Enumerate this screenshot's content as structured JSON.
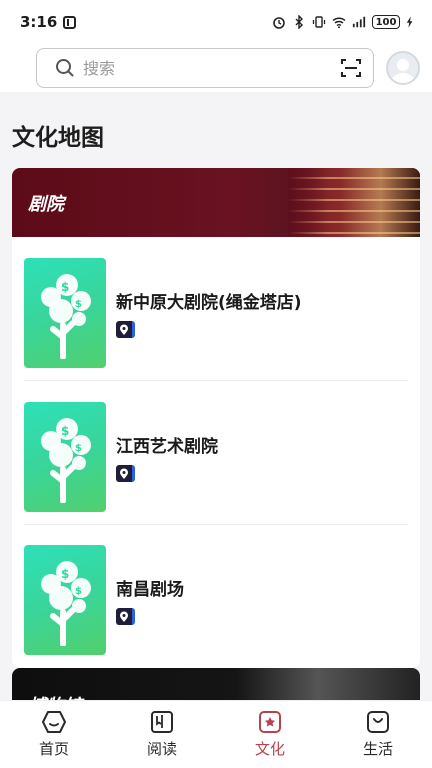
{
  "status_bar": {
    "time": "3:16",
    "battery": "100"
  },
  "search": {
    "placeholder": "搜索",
    "value": ""
  },
  "page": {
    "title": "文化地图"
  },
  "section": {
    "title": "剧院",
    "venues": [
      {
        "name": "新中原大剧院(绳金塔店)"
      },
      {
        "name": "江西艺术剧院"
      },
      {
        "name": "南昌剧场"
      }
    ]
  },
  "next_section": {
    "title": "博物馆"
  },
  "tabs": [
    {
      "label": "首页",
      "icon": "home-icon"
    },
    {
      "label": "阅读",
      "icon": "book-icon"
    },
    {
      "label": "文化",
      "icon": "star-badge-icon",
      "active": true
    },
    {
      "label": "生活",
      "icon": "bag-icon"
    }
  ],
  "colors": {
    "accent": "#b8424d",
    "banner": "#5c0b18",
    "thumbnail": "#39d59a"
  }
}
